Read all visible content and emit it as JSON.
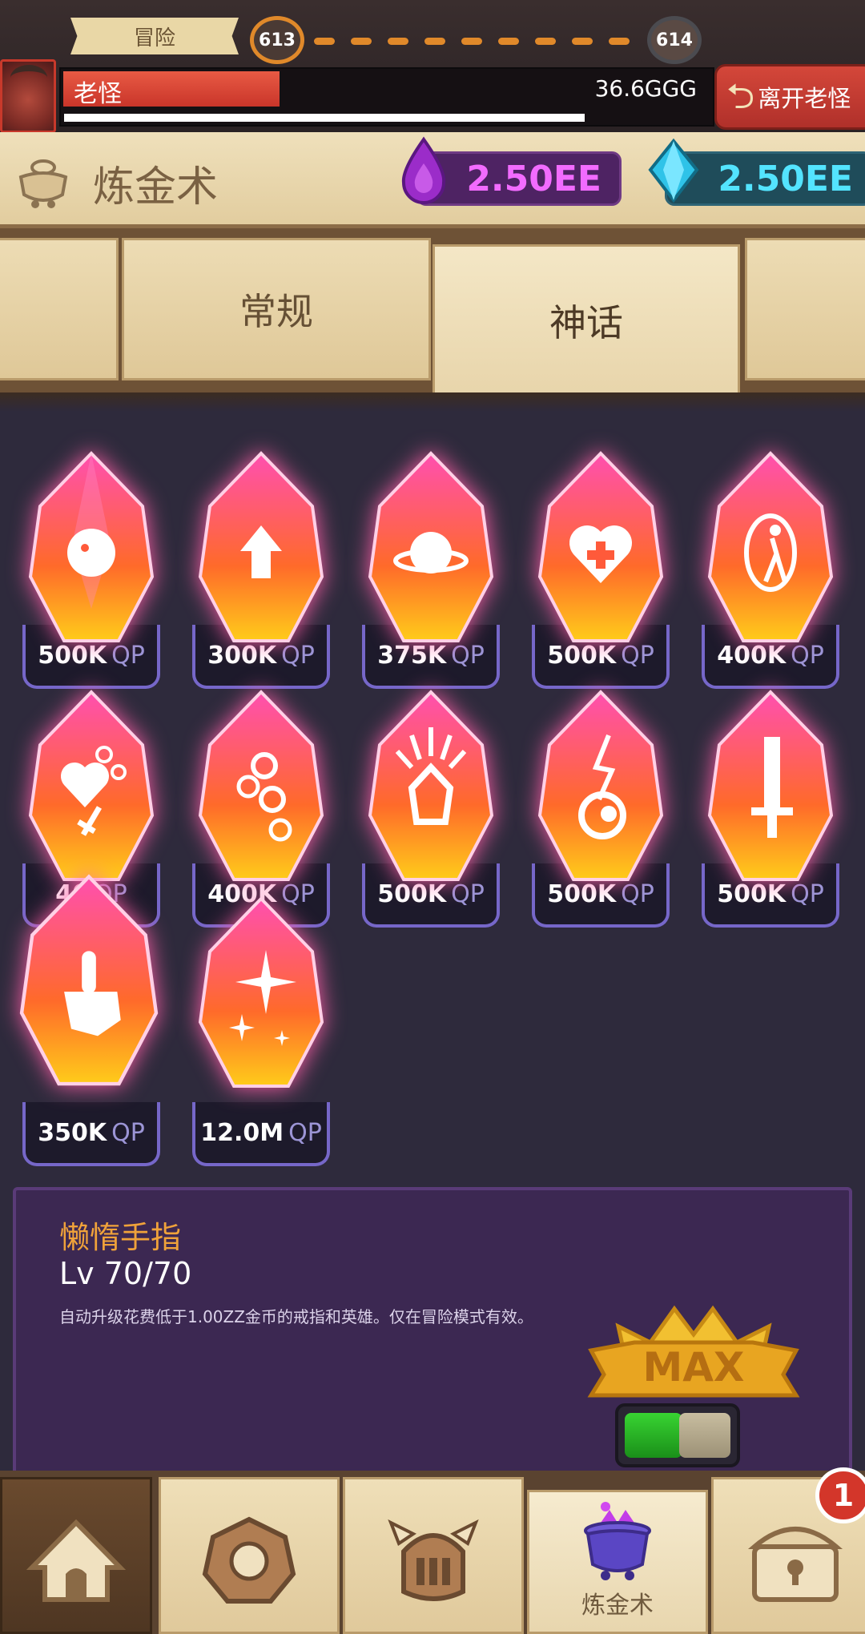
{
  "topbar": {
    "adventure_label": "冒险",
    "stage_current": "613",
    "stage_next": "614",
    "boss_name": "老怪",
    "boss_hp": "36.6GGG",
    "leave_button": "离开老怪"
  },
  "panel": {
    "title": "炼金术",
    "currency_purple": "2.50EE",
    "currency_cyan": "2.50EE"
  },
  "tabs": {
    "normal": "常规",
    "myth": "神话"
  },
  "crystals": [
    {
      "icon": "goblin-icon",
      "cost": "500K",
      "unit": "QP"
    },
    {
      "icon": "arrow-up-icon",
      "cost": "300K",
      "unit": "QP"
    },
    {
      "icon": "planet-icon",
      "cost": "375K",
      "unit": "QP"
    },
    {
      "icon": "heart-plus-icon",
      "cost": "500K",
      "unit": "QP"
    },
    {
      "icon": "portal-walker-icon",
      "cost": "400K",
      "unit": "QP"
    },
    {
      "icon": "heart-sword-coins-icon",
      "cost": "40",
      "unit": "QP"
    },
    {
      "icon": "coins-icon",
      "cost": "400K",
      "unit": "QP"
    },
    {
      "icon": "meteor-icon",
      "cost": "500K",
      "unit": "QP"
    },
    {
      "icon": "fire-swirl-icon",
      "cost": "500K",
      "unit": "QP"
    },
    {
      "icon": "sword-icon",
      "cost": "500K",
      "unit": "QP"
    },
    {
      "icon": "lazy-finger-icon",
      "cost": "350K",
      "unit": "QP"
    },
    {
      "icon": "sparkle-icon",
      "cost": "12.0M",
      "unit": "QP"
    }
  ],
  "detail": {
    "name": "懒惰手指",
    "level": "Lv 70/70",
    "description": "自动升级花费低于1.00ZZ金币的戒指和英雄。仅在冒险模式有效。",
    "max_label": "MAX"
  },
  "nav": {
    "alchemy_label": "炼金术",
    "badge_count": "1"
  },
  "colors": {
    "purple_currency": "#f26bff",
    "cyan_currency": "#53e4ff",
    "qp_label": "#9c95d6",
    "detail_name": "#f0a23a"
  }
}
